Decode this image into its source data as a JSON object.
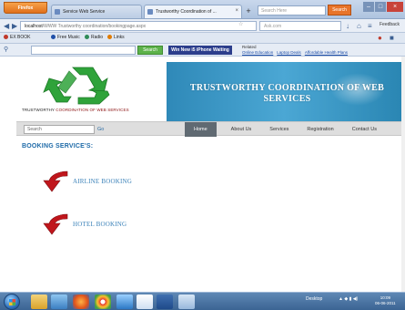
{
  "browser": {
    "menu_button": "Firefox",
    "tabs": [
      {
        "title": "Service Web Service"
      },
      {
        "title": "Trustworthy Coordination of ..."
      }
    ],
    "toolbar_search_placeholder": "Search Here",
    "toolbar_search_button": "Search",
    "url_host": "localhost",
    "url_path": "/WWW Trustworthy coordination/bookingpage.aspx",
    "nav_search_placeholder": "Ask.com",
    "feedback_label": "Feedback",
    "bookmarks": [
      {
        "label": "EX BOOK",
        "color": "#c0392b"
      },
      {
        "label": "Free Music",
        "color": "#1f4fa8"
      },
      {
        "label": "Radio",
        "color": "#2e8b57"
      },
      {
        "label": "Links",
        "color": "#e07b00"
      }
    ],
    "searchbar_button": "Search",
    "iphone_button": "Win New i5 iPhone Waiting",
    "sponsored_label": "Related",
    "sponsored_links": [
      "Online Education",
      "Laptop Deals",
      "Affordable Health Plans"
    ]
  },
  "site": {
    "logo_caption_lead": "TRUSTWORTHY",
    "logo_caption_rest": "COORDINATION OF WEB SERVICES",
    "banner_title": "TRUSTWORTHY COORDINATION OF WEB SERVICES",
    "search_placeholder": "Search",
    "go_label": "Go",
    "menu": [
      "Home",
      "About Us",
      "Services",
      "Registration",
      "Contact Us"
    ],
    "section_title": "BOOKING SERVICE'S:",
    "services": [
      {
        "label": "AIRLINE BOOKING"
      },
      {
        "label": "HOTEL BOOKING"
      }
    ]
  },
  "taskbar": {
    "tray_text": "Desktop",
    "time": "10:09",
    "date": "06-06-2011"
  },
  "colors": {
    "banner_blue": "#3a97c6",
    "section_title": "#1e6aa8",
    "arrow_red": "#c0161c",
    "recycle_green": "#2fa33a",
    "link_blue": "#3b82b9"
  }
}
